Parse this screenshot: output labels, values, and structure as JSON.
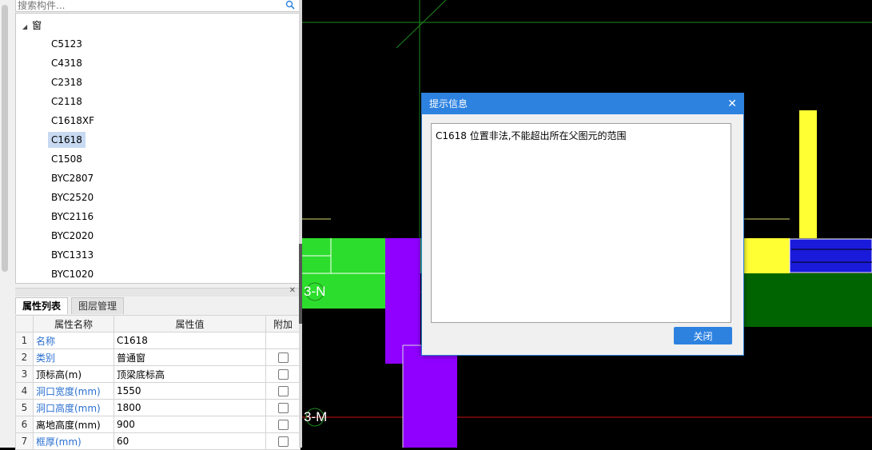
{
  "search": {
    "placeholder": "搜索构件..."
  },
  "tree": {
    "root_label": "窗",
    "items": [
      "C5123",
      "C4318",
      "C2318",
      "C2118",
      "C1618XF",
      "C1618",
      "C1508",
      "BYC2807",
      "BYC2520",
      "BYC2116",
      "BYC2020",
      "BYC1313",
      "BYC1020"
    ],
    "selected": "C1618"
  },
  "tabs": {
    "properties": "属性列表",
    "layers": "图层管理"
  },
  "properties": {
    "headers": [
      "属性名称",
      "属性值",
      "附加"
    ],
    "rows": [
      {
        "idx": "1",
        "name": "名称",
        "value": "C1618",
        "blue": true,
        "check": false
      },
      {
        "idx": "2",
        "name": "类别",
        "value": "普通窗",
        "blue": true,
        "check": true
      },
      {
        "idx": "3",
        "name": "顶标高(m)",
        "value": "顶梁底标高",
        "blue": false,
        "check": true
      },
      {
        "idx": "4",
        "name": "洞口宽度(mm)",
        "value": "1550",
        "blue": true,
        "check": true
      },
      {
        "idx": "5",
        "name": "洞口高度(mm)",
        "value": "1800",
        "blue": true,
        "check": true
      },
      {
        "idx": "6",
        "name": "离地高度(mm)",
        "value": "900",
        "blue": false,
        "check": true
      },
      {
        "idx": "7",
        "name": "框厚(mm)",
        "value": "60",
        "blue": true,
        "check": true
      }
    ]
  },
  "canvas": {
    "axis_labels": [
      "3-N",
      "3-M"
    ]
  },
  "dialog": {
    "title": "提示信息",
    "message": "C1618 位置非法,不能超出所在父图元的范围",
    "button": "关闭"
  },
  "colors": {
    "accent": "#2d82e0",
    "link_blue": "#2a6fd1",
    "wall_green": "#2ddd2d",
    "window_purple": "#8f00ff",
    "column_yellow": "#ffff33"
  }
}
